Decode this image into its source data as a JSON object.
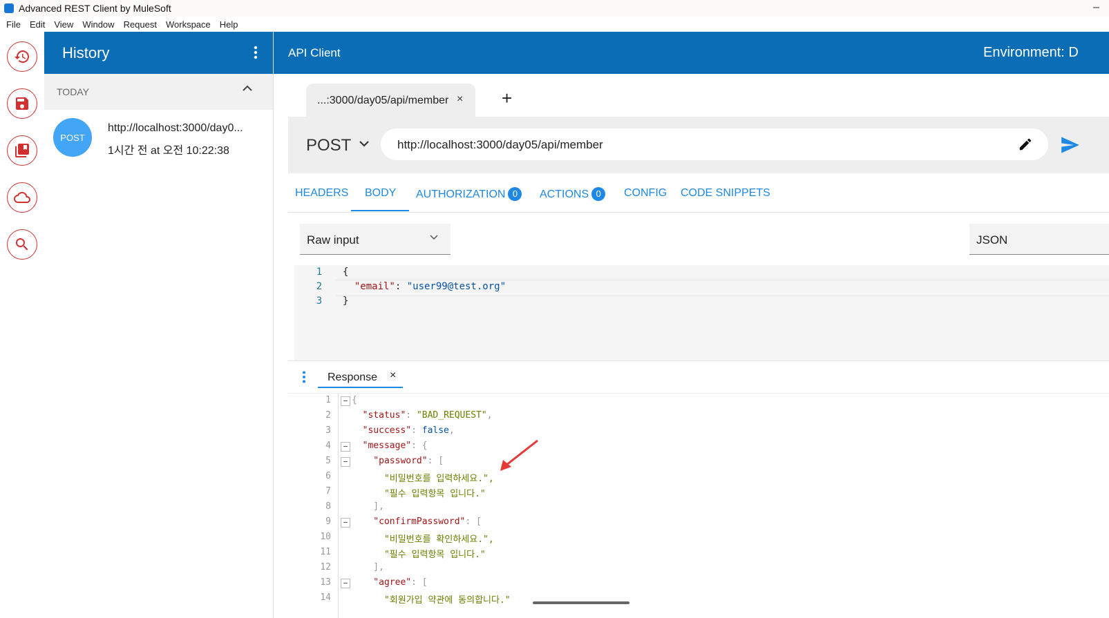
{
  "window": {
    "title": "Advanced REST Client by MuleSoft",
    "minimize": "–"
  },
  "menu": [
    "File",
    "Edit",
    "View",
    "Window",
    "Request",
    "Workspace",
    "Help"
  ],
  "rail": [
    "history-icon",
    "save-icon",
    "saved-collections-icon",
    "cloud-icon",
    "search-icon"
  ],
  "history": {
    "title": "History",
    "group_label": "TODAY",
    "items": [
      {
        "method": "POST",
        "url": "http://localhost:3000/day0...",
        "time": "1시간 전 at 오전 10:22:38"
      }
    ]
  },
  "main": {
    "title": "API Client",
    "environment": "Environment: D",
    "tab_label": "...:3000/day05/api/member",
    "tab_close": "×",
    "add_tab": "+",
    "method": "POST",
    "url": "http://localhost:3000/day05/api/member"
  },
  "subtabs": {
    "headers": "HEADERS",
    "body": "BODY",
    "authorization": "AUTHORIZATION",
    "authorization_count": "0",
    "actions": "ACTIONS",
    "actions_count": "0",
    "config": "CONFIG",
    "code_snippets": "CODE SNIPPETS"
  },
  "body_editor": {
    "mode": "Raw input",
    "content_type": "JSON",
    "line_numbers": [
      "1",
      "2",
      "3"
    ],
    "lines": [
      "{",
      "  \"email\": \"user99@test.org\"",
      "}"
    ]
  },
  "response": {
    "tab_label": "Response",
    "tab_close": "×",
    "line_numbers": [
      "1",
      "2",
      "3",
      "4",
      "5",
      "6",
      "7",
      "8",
      "9",
      "10",
      "11",
      "12",
      "13",
      "14"
    ],
    "lines": [
      "{",
      "  \"status\": \"BAD_REQUEST\",",
      "  \"success\": false,",
      "  \"message\": {",
      "    \"password\": [",
      "      \"비밀번호를 입력하세요.\",",
      "      \"필수 입력항목 입니다.\"",
      "    ],",
      "    \"confirmPassword\": [",
      "      \"비밀번호를 확인하세요.\",",
      "      \"필수 입력항목 입니다.\"",
      "    ],",
      "    \"agree\": [",
      "      \"회원가입 약관에 동의합니다.\""
    ],
    "fold_marker": "−"
  },
  "colors": {
    "header_blue": "#0a6db5",
    "accent_blue": "#1e88e5",
    "rail_red": "#d32f2f",
    "annotation_arrow": "#e53935"
  }
}
